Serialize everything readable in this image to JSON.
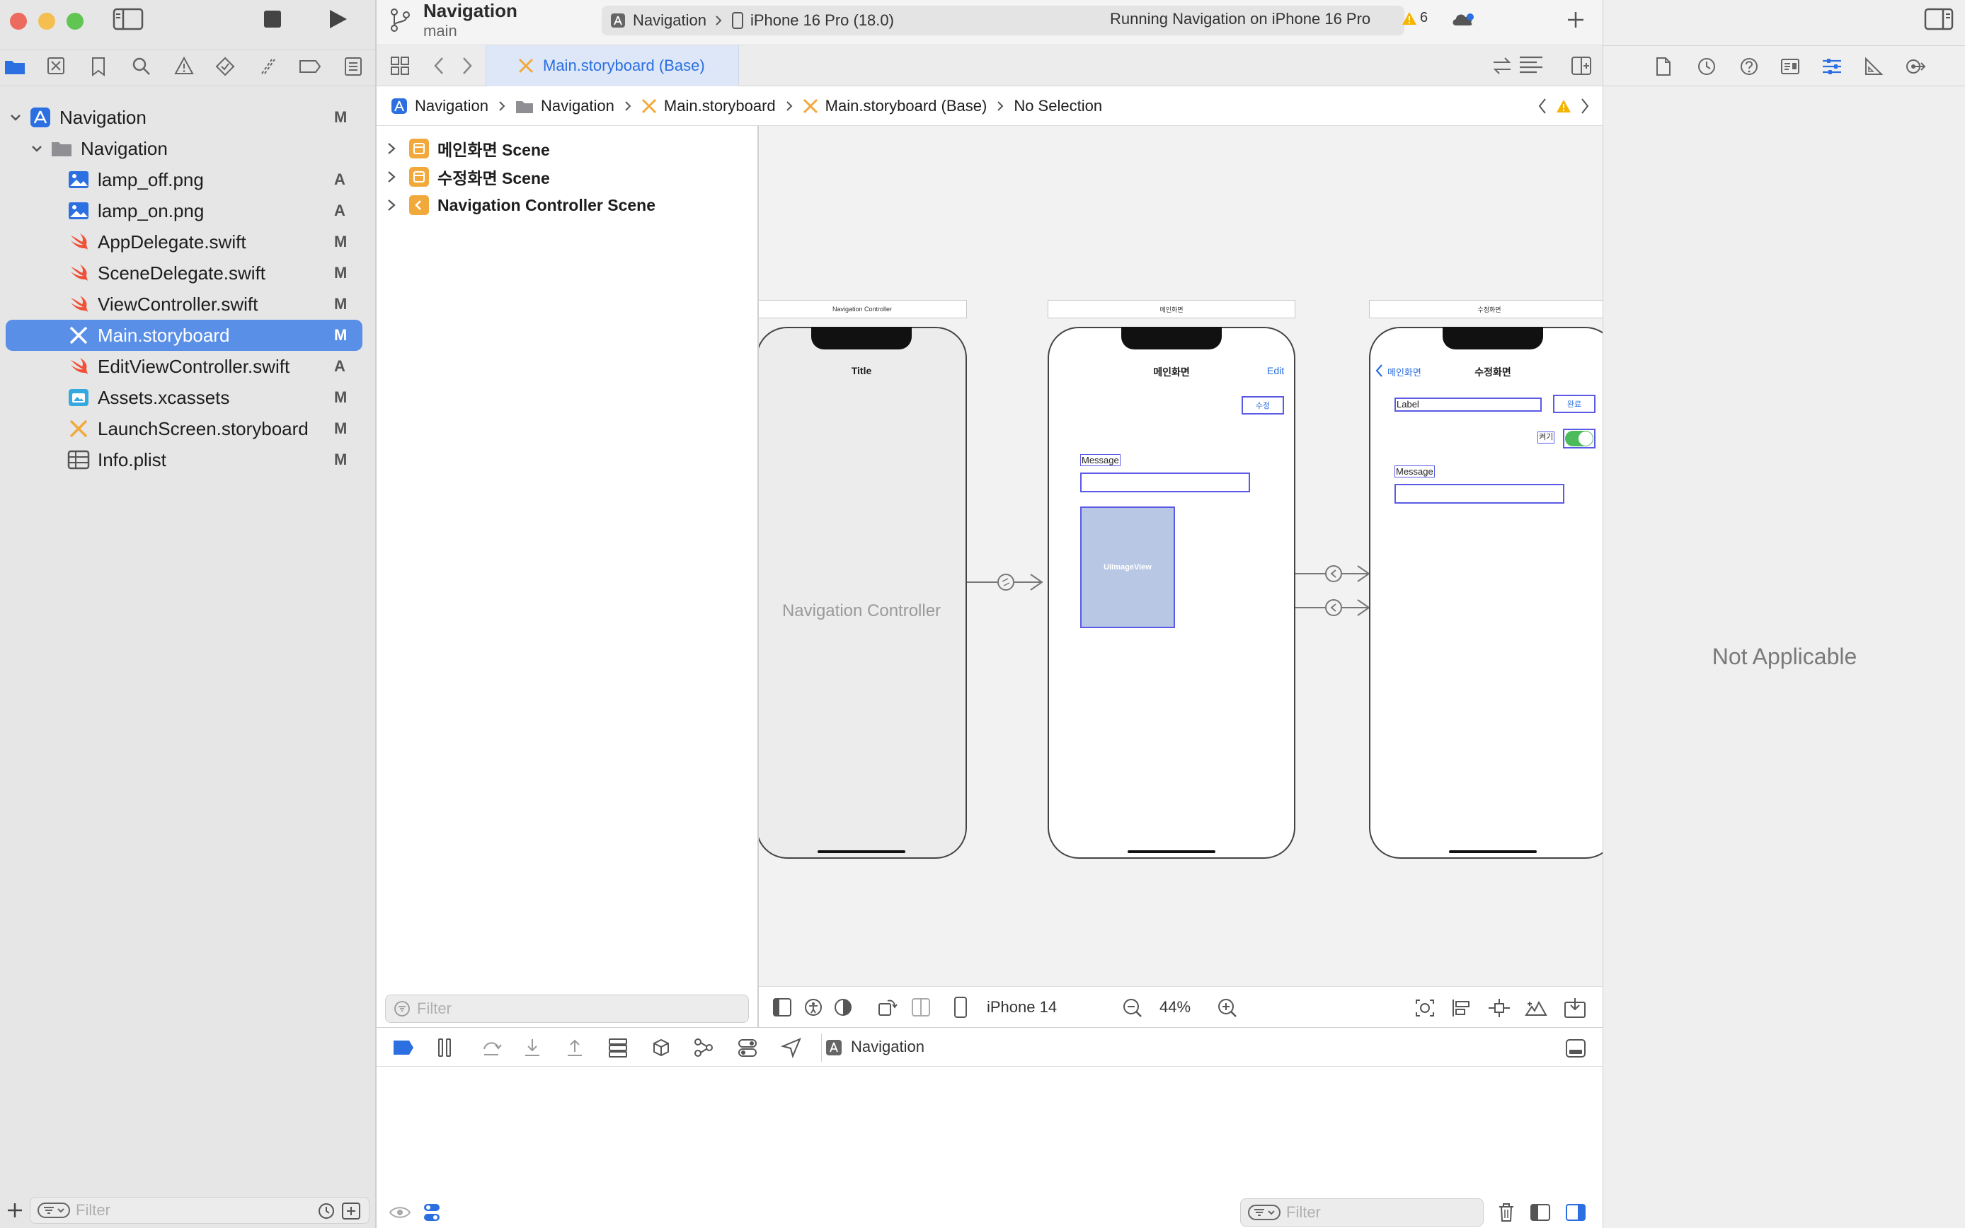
{
  "project": {
    "name": "Navigation",
    "branch": "main"
  },
  "scheme": {
    "target": "Navigation",
    "device": "iPhone 16 Pro (18.0)",
    "status": "Running Navigation on iPhone 16 Pro",
    "warnings": "6"
  },
  "navigator": {
    "items": [
      {
        "label": "Navigation",
        "badge": "M",
        "icon": "app-project-icon"
      },
      {
        "label": "Navigation",
        "badge": "",
        "icon": "folder-icon"
      },
      {
        "label": "lamp_off.png",
        "badge": "A",
        "icon": "image-file-icon"
      },
      {
        "label": "lamp_on.png",
        "badge": "A",
        "icon": "image-file-icon"
      },
      {
        "label": "AppDelegate.swift",
        "badge": "M",
        "icon": "swift-file-icon"
      },
      {
        "label": "SceneDelegate.swift",
        "badge": "M",
        "icon": "swift-file-icon"
      },
      {
        "label": "ViewController.swift",
        "badge": "M",
        "icon": "swift-file-icon"
      },
      {
        "label": "Main.storyboard",
        "badge": "M",
        "icon": "storyboard-file-icon"
      },
      {
        "label": "EditViewController.swift",
        "badge": "A",
        "icon": "swift-file-icon"
      },
      {
        "label": "Assets.xcassets",
        "badge": "M",
        "icon": "assets-file-icon"
      },
      {
        "label": "LaunchScreen.storyboard",
        "badge": "M",
        "icon": "storyboard-file-icon"
      },
      {
        "label": "Info.plist",
        "badge": "M",
        "icon": "plist-file-icon"
      }
    ],
    "filter_placeholder": "Filter"
  },
  "editor": {
    "tab": "Main.storyboard (Base)",
    "breadcrumb": [
      "Navigation",
      "Navigation",
      "Main.storyboard",
      "Main.storyboard (Base)",
      "No Selection"
    ]
  },
  "outline": {
    "scenes": [
      "메인화면 Scene",
      "수정화면 Scene",
      "Navigation Controller Scene"
    ],
    "filter_placeholder": "Filter"
  },
  "canvas": {
    "nav_controller": {
      "header": "Navigation Controller",
      "title": "Title",
      "body": "Navigation Controller"
    },
    "main_scene": {
      "header": "메인화면",
      "title": "메인화면",
      "edit": "Edit",
      "edit_button": "수정",
      "message": "Message",
      "image_view": "UIImageView"
    },
    "edit_scene": {
      "header": "수정화면",
      "back": "메인화면",
      "title": "수정화면",
      "label": "Label",
      "done_button": "완료",
      "switch_label": "켜기",
      "message": "Message"
    },
    "device": "iPhone 14",
    "zoom": "44%"
  },
  "debug": {
    "target": "Navigation",
    "filter_placeholder": "Filter"
  },
  "inspector": {
    "empty_message": "Not Applicable"
  },
  "colors": {
    "accent": "#2b6fe0",
    "selection": "#5a8fe8",
    "swift": "#f05138",
    "storyboard": "#f2a93b"
  }
}
